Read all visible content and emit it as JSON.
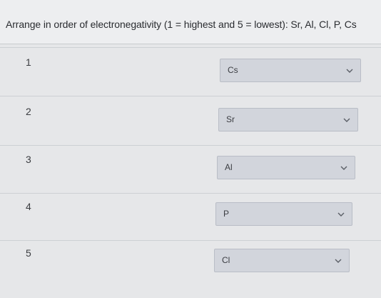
{
  "question": {
    "text": "Arrange in order of electronegativity (1 = highest and 5 = lowest): Sr, Al, Cl, P, Cs"
  },
  "rows": [
    {
      "number": "1",
      "selected": "Cs"
    },
    {
      "number": "2",
      "selected": "Sr"
    },
    {
      "number": "3",
      "selected": "Al"
    },
    {
      "number": "4",
      "selected": "P"
    },
    {
      "number": "5",
      "selected": "Cl"
    }
  ],
  "colors": {
    "background": "#e6e7e9",
    "select_fill": "#d2d5dc",
    "select_border": "#b9bdc6"
  },
  "icons": {
    "dropdown": "chevron-down-icon"
  }
}
